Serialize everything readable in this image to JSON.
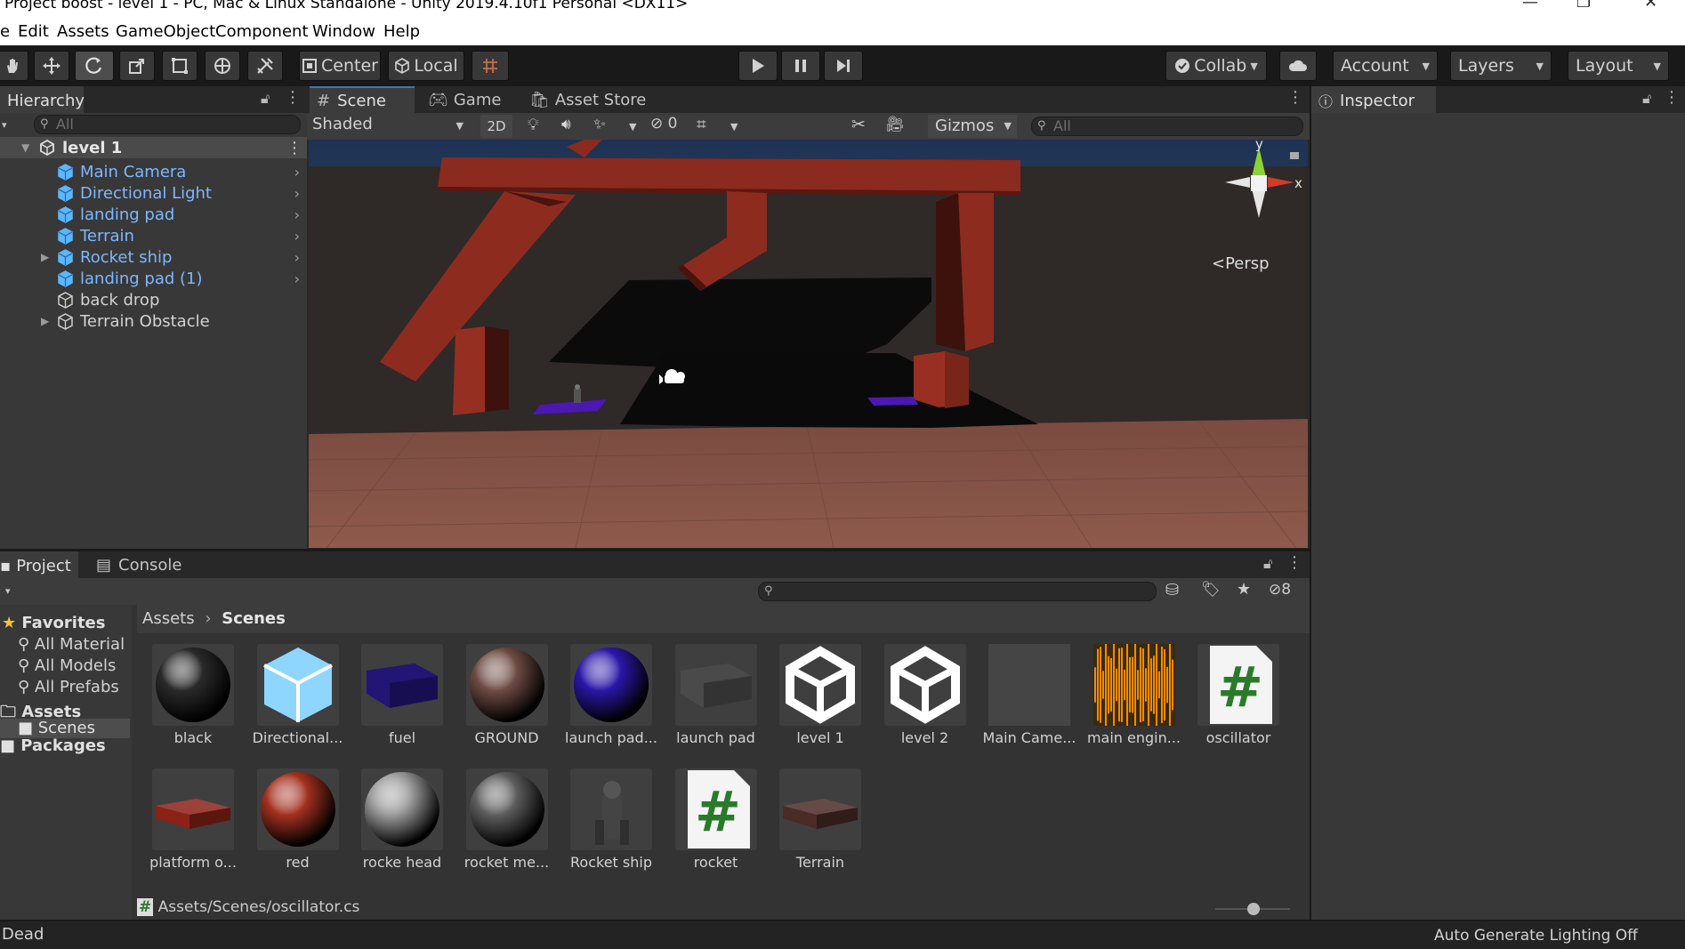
{
  "window": {
    "title": "Project boost - level 1 - PC, Mac & Linux Standalone - Unity 2019.4.10f1 Personal <DX11>",
    "controls": [
      "—",
      "❐",
      "✕"
    ]
  },
  "menu": [
    "e",
    "Edit",
    "Assets",
    "GameObject",
    "Component",
    "Window",
    "Help"
  ],
  "toolbar": {
    "pivot_label": "Center",
    "space_label": "Local",
    "collab_label": "Collab",
    "account_label": "Account",
    "layers_label": "Layers",
    "layout_label": "Layout"
  },
  "hierarchy": {
    "tab": "Hierarchy",
    "search_placeholder": "All",
    "scene_name": "level 1",
    "items": [
      {
        "name": "Main Camera"
      },
      {
        "name": "Directional Light"
      },
      {
        "name": "landing pad"
      },
      {
        "name": "Terrain"
      },
      {
        "name": "Rocket ship"
      },
      {
        "name": "landing pad (1)"
      },
      {
        "name": "back drop"
      },
      {
        "name": "Terrain Obstacle"
      }
    ]
  },
  "scene_view": {
    "tabs": [
      "Scene",
      "Game",
      "Asset Store"
    ],
    "shading": "Shaded",
    "mode_2d": "2D",
    "hidden_count": "0",
    "gizmos_label": "Gizmos",
    "search_placeholder": "All",
    "projection": "Persp",
    "axis_y": "y",
    "axis_x": "x"
  },
  "inspector": {
    "tab": "Inspector"
  },
  "project": {
    "tabs": [
      "Project",
      "Console"
    ],
    "hidden_count": "8",
    "favorites_label": "Favorites",
    "favorites": [
      "All Material",
      "All Models",
      "All Prefabs"
    ],
    "assets_label": "Assets",
    "scenes_label": "Scenes",
    "packages_label": "Packages",
    "breadcrumb": [
      "Assets",
      "Scenes"
    ],
    "assets": [
      {
        "name": "black",
        "kind": "sphere",
        "color": "#2a2a2a"
      },
      {
        "name": "Directional...",
        "kind": "lightcube",
        "color": "#5bc0ff"
      },
      {
        "name": "fuel",
        "kind": "box",
        "color": "#221575"
      },
      {
        "name": "GROUND",
        "kind": "sphere",
        "color": "#6e4b44"
      },
      {
        "name": "launch pad...",
        "kind": "sphere",
        "color": "#2a17a8"
      },
      {
        "name": "launch pad",
        "kind": "box",
        "color": "#4a4a4a"
      },
      {
        "name": "level 1",
        "kind": "unity",
        "color": "#ffffff"
      },
      {
        "name": "level 2",
        "kind": "unity",
        "color": "#ffffff"
      },
      {
        "name": "Main Came...",
        "kind": "blank",
        "color": "#454545"
      },
      {
        "name": "main engin...",
        "kind": "audio",
        "color": "#ff8a00"
      },
      {
        "name": "oscillator",
        "kind": "script",
        "color": "#2a7a2a"
      },
      {
        "name": "platform o...",
        "kind": "flatbox",
        "color": "#8a2218"
      },
      {
        "name": "red",
        "kind": "sphere",
        "color": "#a3301f"
      },
      {
        "name": "rocke head",
        "kind": "sphere",
        "color": "#9a9a9a"
      },
      {
        "name": "rocket me...",
        "kind": "sphere",
        "color": "#5d5d5d"
      },
      {
        "name": "Rocket ship",
        "kind": "rocket",
        "color": "#3c3c3c"
      },
      {
        "name": "rocket",
        "kind": "script",
        "color": "#2a7a2a"
      },
      {
        "name": "Terrain",
        "kind": "flatbox",
        "color": "#4a2b27"
      }
    ],
    "selected_path": "Assets/Scenes/oscillator.cs"
  },
  "status": {
    "left": "Dead",
    "right": "Auto Generate Lighting Off"
  }
}
